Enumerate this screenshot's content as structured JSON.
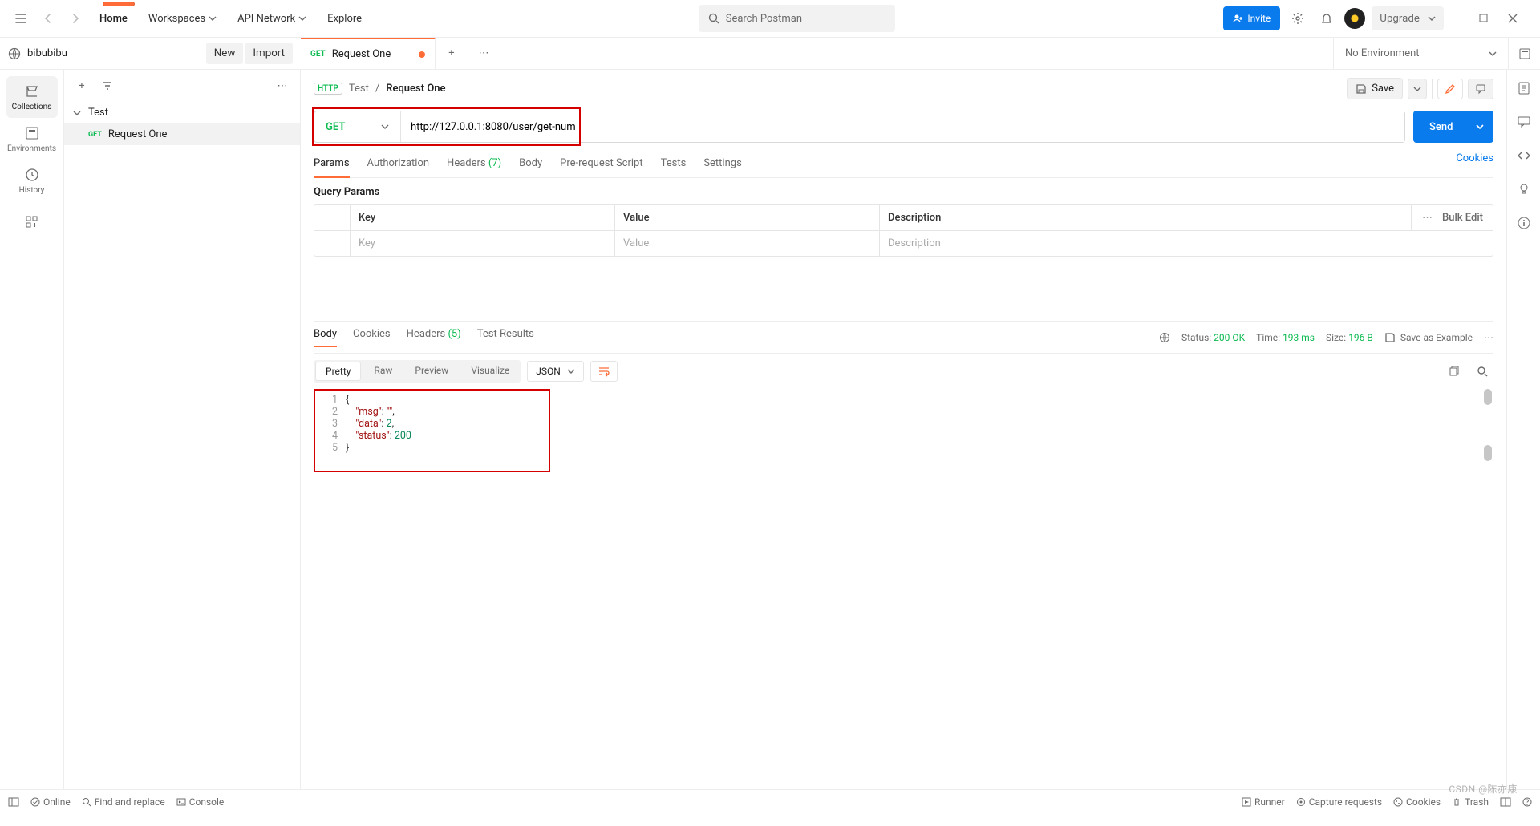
{
  "topnav": {
    "home": "Home",
    "workspaces": "Workspaces",
    "api_network": "API Network",
    "explore": "Explore",
    "search_placeholder": "Search Postman",
    "invite": "Invite",
    "upgrade": "Upgrade"
  },
  "workspace": {
    "name": "bibubibu",
    "new_btn": "New",
    "import_btn": "Import",
    "env": "No Environment"
  },
  "sidebar": {
    "items": [
      {
        "label": "Collections"
      },
      {
        "label": "Environments"
      },
      {
        "label": "History"
      }
    ]
  },
  "tree": {
    "folder": "Test",
    "request": "Request One",
    "request_method": "GET"
  },
  "tabs": {
    "active_method": "GET",
    "active_title": "Request One"
  },
  "breadcrumb": {
    "http": "HTTP",
    "folder": "Test",
    "sep": "/",
    "name": "Request One",
    "save": "Save"
  },
  "request": {
    "method": "GET",
    "url": "http://127.0.0.1:8080/user/get-num",
    "send": "Send"
  },
  "req_tabs": {
    "params": "Params",
    "auth": "Authorization",
    "headers": "Headers",
    "headers_count": "(7)",
    "body": "Body",
    "prereq": "Pre-request Script",
    "tests": "Tests",
    "settings": "Settings",
    "cookies": "Cookies"
  },
  "params_section": {
    "title": "Query Params",
    "col_key": "Key",
    "col_val": "Value",
    "col_desc": "Description",
    "ph_key": "Key",
    "ph_val": "Value",
    "ph_desc": "Description",
    "bulk": "Bulk Edit"
  },
  "response": {
    "tab_body": "Body",
    "tab_cookies": "Cookies",
    "tab_headers": "Headers",
    "tab_headers_count": "(5)",
    "tab_tests": "Test Results",
    "status_label": "Status:",
    "status_value": "200 OK",
    "time_label": "Time:",
    "time_value": "193 ms",
    "size_label": "Size:",
    "size_value": "196 B",
    "save_example": "Save as Example",
    "view_pretty": "Pretty",
    "view_raw": "Raw",
    "view_preview": "Preview",
    "view_visualize": "Visualize",
    "format": "JSON",
    "body_json": {
      "msg": "",
      "data": 2,
      "status": 200
    }
  },
  "statusbar": {
    "online": "Online",
    "find": "Find and replace",
    "console": "Console",
    "runner": "Runner",
    "capture": "Capture requests",
    "cookies": "Cookies",
    "trash": "Trash"
  },
  "watermark": "CSDN @陈亦康"
}
